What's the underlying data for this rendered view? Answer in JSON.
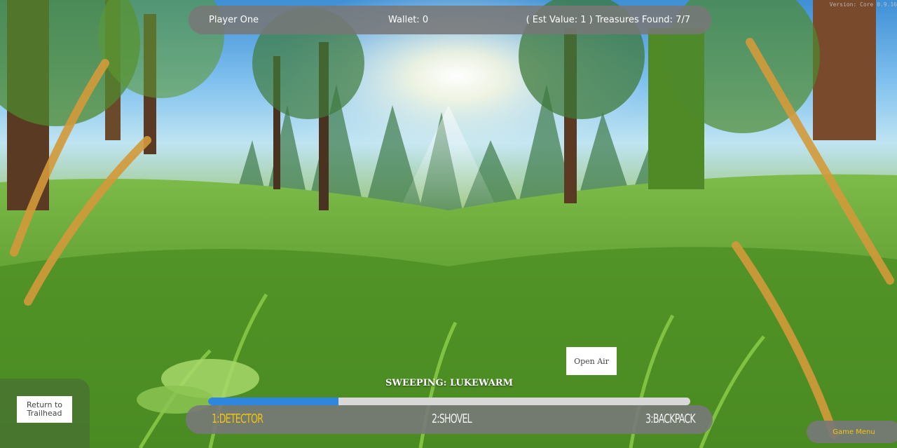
{
  "version": "Version: Core 0.9.16",
  "hud": {
    "player_name": "Player One",
    "wallet": "Wallet: 0",
    "treasures": "( Est Value: 1 ) Treasures Found: 7/7"
  },
  "sweep": {
    "status": "SWEEPING: LUKEWARM",
    "progress_fraction": 0.27,
    "progress_color": "#2e86de"
  },
  "tools": {
    "items": [
      {
        "label": "1:DETECTOR",
        "active": true
      },
      {
        "label": "2:SHOVEL",
        "active": false
      },
      {
        "label": "3:BACKPACK",
        "active": false
      }
    ],
    "active_color": "#f1c40f"
  },
  "buttons": {
    "open_air": "Open Air",
    "return_trailhead": "Return to Trailhead",
    "game_menu": "Game Menu"
  },
  "scene": {
    "description_icon": "forest-meadow-background"
  }
}
